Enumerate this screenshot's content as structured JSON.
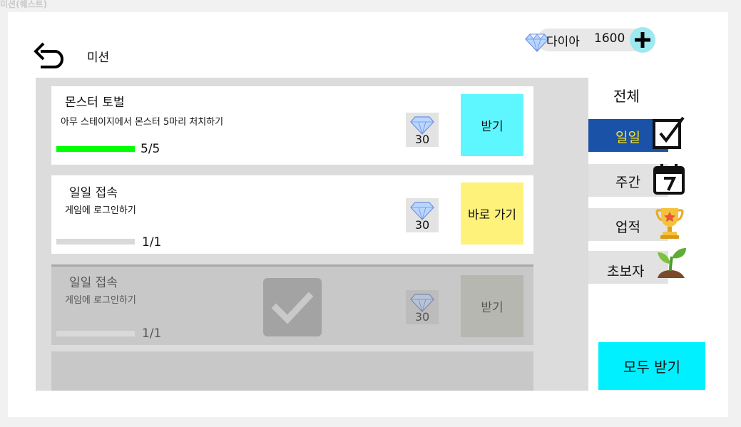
{
  "frame_label": "미션(퀘스트)",
  "header": {
    "title": "미션"
  },
  "currency": {
    "label": "다이아",
    "value": "1600"
  },
  "missions": [
    {
      "title": "몬스터 토벌",
      "description": "아무 스테이지에서 몬스터 5마리 처치하기",
      "progress_text": "5/5",
      "progress": 1.0,
      "reward": "30",
      "action": "받기",
      "action_color": "#5ff7ff",
      "state": "claimable"
    },
    {
      "title": "일일 접속",
      "description": "게임에 로그인하기",
      "progress_text": "1/1",
      "progress": 0.0,
      "reward": "30",
      "action": "바로 가기",
      "action_color": "#fff27a",
      "state": "go"
    },
    {
      "title": "일일 접속",
      "description": "게임에 로그인하기",
      "progress_text": "1/1",
      "progress": 0.0,
      "reward": "30",
      "action": "받기",
      "action_color": "#b7b7b2",
      "state": "completed"
    }
  ],
  "tabs": {
    "header": "전체",
    "items": [
      {
        "label": "일일",
        "icon": "check-box-icon",
        "active": true
      },
      {
        "label": "주간",
        "icon": "calendar-icon",
        "active": false
      },
      {
        "label": "업적",
        "icon": "trophy-icon",
        "active": false
      },
      {
        "label": "초보자",
        "icon": "sprout-icon",
        "active": false
      }
    ]
  },
  "claim_all": "모두 받기"
}
